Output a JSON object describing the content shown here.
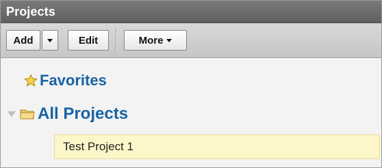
{
  "panel": {
    "title": "Projects"
  },
  "toolbar": {
    "add_label": "Add",
    "edit_label": "Edit",
    "more_label": "More"
  },
  "tree": {
    "favorites_label": "Favorites",
    "all_projects_label": "All Projects",
    "projects": [
      {
        "label": "Test Project 1"
      }
    ]
  },
  "icons": {
    "favorites": "star-icon",
    "all_projects": "folder-icon",
    "expander": "expand-triangle-icon",
    "dropdown": "caret-down-icon"
  },
  "colors": {
    "link_blue": "#1763a5",
    "title_bar": "#6a6a6a",
    "selected_item": "#fdf6c9",
    "star_fill": "#f6d24a"
  }
}
